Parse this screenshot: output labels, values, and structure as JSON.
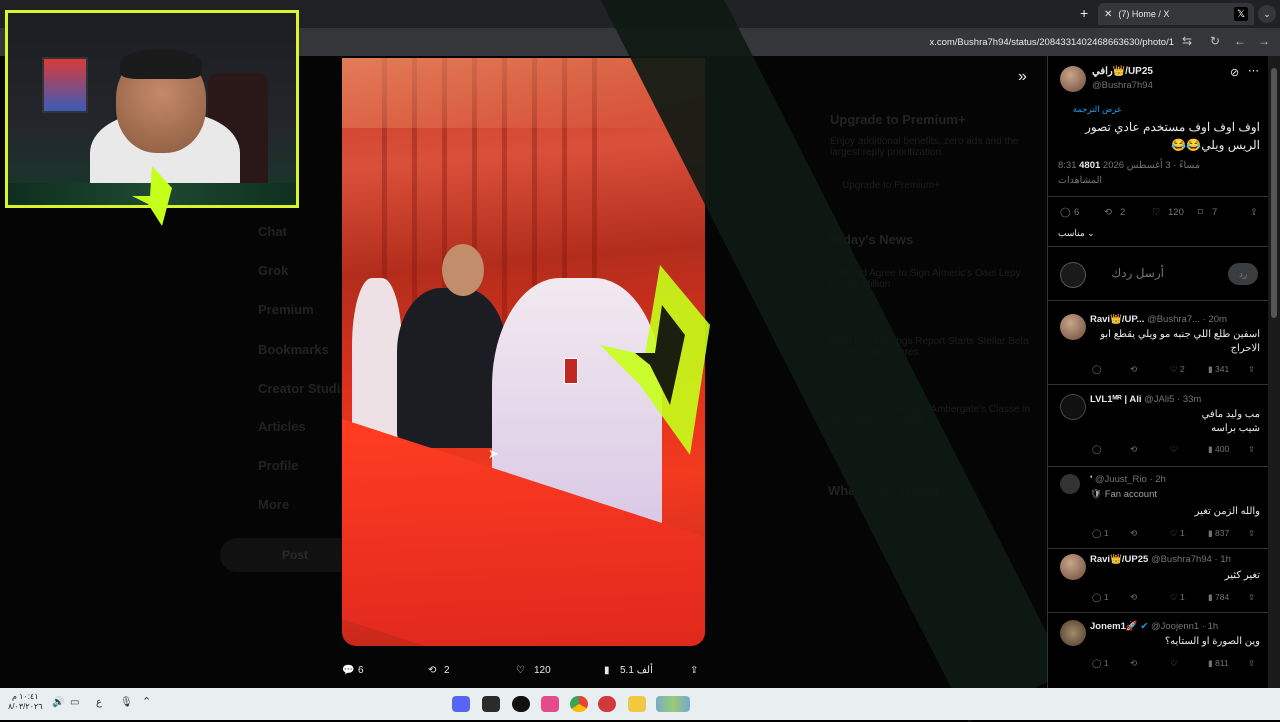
{
  "browser": {
    "tab_title": "(7) Home / X",
    "url": "x.com/Bushra7h94/status/2084331402468663630/photo/1"
  },
  "background_page": {
    "premium_title": "Upgrade to Premium+",
    "premium_desc": "Enjoy additional benefits, zero ads and the largest reply prioritization.",
    "premium_button": "Upgrade to Premium+",
    "news_title": "Today's News",
    "news_items": [
      "Al Ittihad Agree to Sign Aimeric's Oaei Lepy for €18 Million",
      "Snap Inc. Earnings Report Starts Stellar Beta and Portfolio Shares",
      "Bitdo CEO Challenges Ambergate's Classe in Musk 100 BTC Wallet"
    ],
    "happening_title": "What's happening",
    "nav": [
      "Chat",
      "Grok",
      "Premium",
      "Bookmarks",
      "Creator Studio",
      "Articles",
      "Profile",
      "More"
    ],
    "post_button": "Post"
  },
  "media_actions": {
    "replies": "6",
    "reposts": "2",
    "likes": "120",
    "views": "5.1 ألف"
  },
  "tweet": {
    "name": "رافي👑/UP25",
    "handle": "@Bushra7h94",
    "translate": "عرض الترجمة",
    "text": "اوف اوف اوف مستخدم عادي تصور الريس ويلي😂😂",
    "time": "8:31 مساءً · 3 أغسطس 2026",
    "views_count": "4801",
    "views_label": "المشاهدات",
    "replies": "6",
    "reposts": "2",
    "likes": "120",
    "bookmarks": "7",
    "sort": "مناسب",
    "reply_placeholder": "أرسل ردك",
    "reply_button": "رد"
  },
  "replies": [
    {
      "name": "Ravi👑/UP...",
      "handle": "@Bushra7...",
      "time": "· 20m",
      "text": "اسفين طلع اللي جنبه مو ويلي يقطع ابو الاحراج",
      "replies": "",
      "reposts": "",
      "likes": "2",
      "views": "341"
    },
    {
      "name": "LVL1ᴹᴿ | Ali",
      "handle": "@JAli5",
      "time": "· 33m",
      "text": "مب وليد مافي شيب براسه",
      "replies": "",
      "reposts": "",
      "likes": "",
      "views": "400"
    },
    {
      "name": "'",
      "handle": "@Juust_Rio",
      "time": "· 2h",
      "badge": "Fan account",
      "text": "والله الزمن تغير",
      "replies": "1",
      "reposts": "",
      "likes": "1",
      "views": "837"
    },
    {
      "name": "Ravi👑/UP25",
      "handle": "@Bushra7h94",
      "time": "· 1h",
      "text": "تغير كثير",
      "replies": "1",
      "reposts": "",
      "likes": "1",
      "views": "784"
    },
    {
      "name": "Jonem1🚀",
      "handle": "@Joojenn1",
      "time": "· 1h",
      "text": "وين الصورة او الستايه؟",
      "replies": "1",
      "reposts": "",
      "likes": "",
      "views": "811"
    }
  ],
  "taskbar": {
    "time": "١٠:٤١ م",
    "date": "٨/٠٣/٢٠٢٦",
    "lang": "ع"
  }
}
